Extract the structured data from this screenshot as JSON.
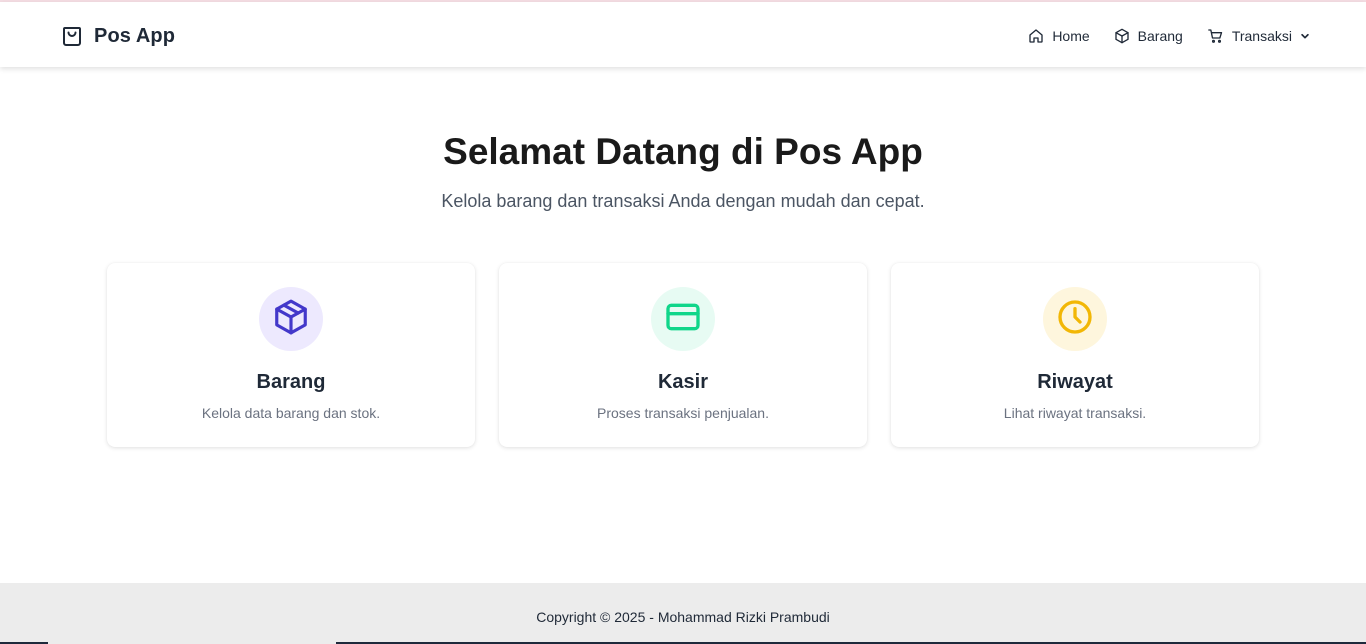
{
  "navbar": {
    "brand": "Pos App",
    "brand_icon": "shopping-bag-icon",
    "items": [
      {
        "label": "Home",
        "icon": "home-icon"
      },
      {
        "label": "Barang",
        "icon": "box-icon"
      },
      {
        "label": "Transaksi",
        "icon": "cart-icon",
        "dropdown": true
      }
    ]
  },
  "hero": {
    "title": "Selamat Datang di Pos App",
    "subtitle": "Kelola barang dan transaksi Anda dengan mudah dan cepat."
  },
  "cards": [
    {
      "title": "Barang",
      "desc": "Kelola data barang dan stok.",
      "icon": "box-icon",
      "icon_color": "#4338ca",
      "icon_bg": "#ede9fe"
    },
    {
      "title": "Kasir",
      "desc": "Proses transaksi penjualan.",
      "icon": "credit-card-icon",
      "icon_color": "#10d68a",
      "icon_bg": "#e7fbf3"
    },
    {
      "title": "Riwayat",
      "desc": "Lihat riwayat transaksi.",
      "icon": "clock-icon",
      "icon_color": "#f2b705",
      "icon_bg": "#fef6dd"
    }
  ],
  "footer": {
    "text": "Copyright © 2025 - Mohammad Rizki Prambudi"
  }
}
